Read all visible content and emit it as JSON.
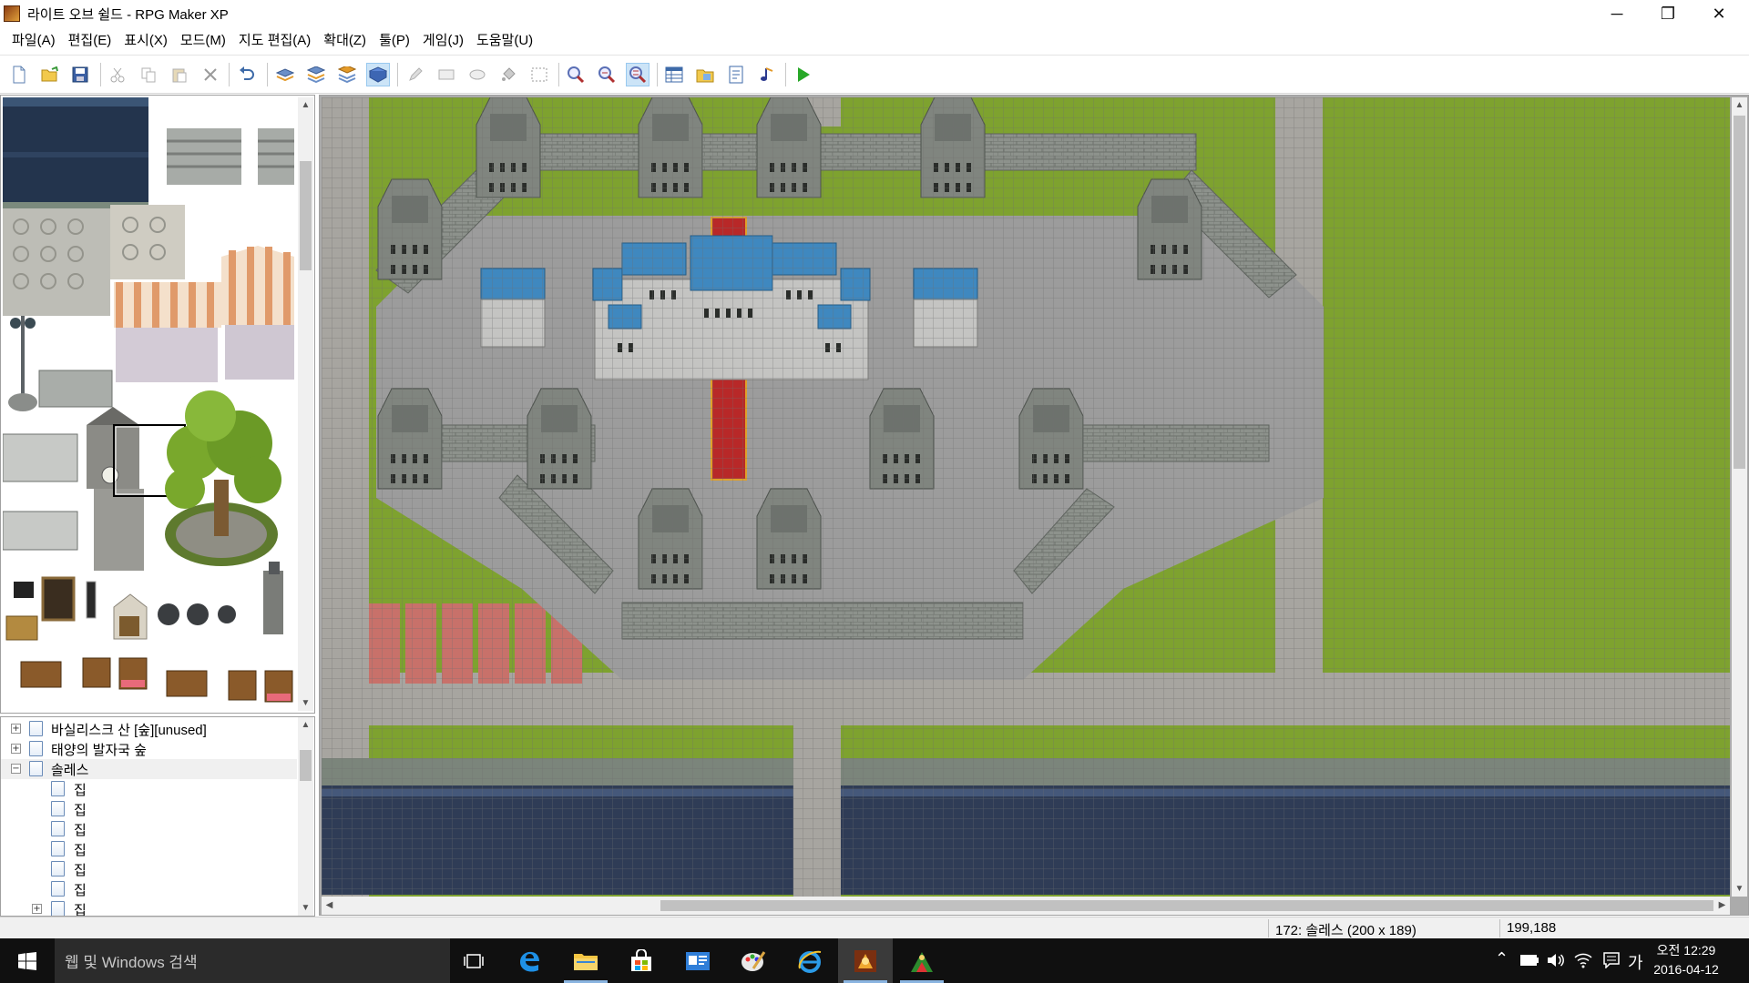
{
  "window": {
    "title": "라이트 오브 쉴드 - RPG Maker XP",
    "app_icon": "rpg-maker-xp-icon",
    "controls": {
      "minimize": "─",
      "restore": "❐",
      "close": "✕"
    }
  },
  "menu": {
    "items": [
      "파일(A)",
      "편집(E)",
      "표시(X)",
      "모드(M)",
      "지도 편집(A)",
      "확대(Z)",
      "툴(P)",
      "게임(J)",
      "도움말(U)"
    ]
  },
  "toolbar": {
    "buttons": [
      {
        "icon": "new-project-icon",
        "pressed": false
      },
      {
        "icon": "open-project-icon",
        "pressed": false
      },
      {
        "icon": "save-icon",
        "pressed": false
      },
      {
        "icon": "cut-icon",
        "pressed": false
      },
      {
        "icon": "copy-icon",
        "pressed": false
      },
      {
        "icon": "paste-icon",
        "pressed": false
      },
      {
        "icon": "delete-icon",
        "pressed": false
      },
      {
        "icon": "undo-icon",
        "pressed": false
      },
      {
        "icon": "layer-1-icon",
        "pressed": false
      },
      {
        "icon": "layer-2-icon",
        "pressed": false
      },
      {
        "icon": "layer-3-icon",
        "pressed": false
      },
      {
        "icon": "event-layer-icon",
        "pressed": true
      },
      {
        "icon": "pencil-icon",
        "pressed": false
      },
      {
        "icon": "rectangle-icon",
        "pressed": false
      },
      {
        "icon": "ellipse-icon",
        "pressed": false
      },
      {
        "icon": "fill-icon",
        "pressed": false
      },
      {
        "icon": "select-icon",
        "pressed": false
      },
      {
        "icon": "zoom-1-1-icon",
        "pressed": false
      },
      {
        "icon": "zoom-1-2-icon",
        "pressed": false
      },
      {
        "icon": "zoom-1-4-icon",
        "pressed": true
      },
      {
        "icon": "database-icon",
        "pressed": false
      },
      {
        "icon": "materials-icon",
        "pressed": false
      },
      {
        "icon": "script-editor-icon",
        "pressed": false
      },
      {
        "icon": "sound-test-icon",
        "pressed": false
      },
      {
        "icon": "playtest-icon",
        "pressed": false
      }
    ]
  },
  "map_tree": {
    "items": [
      {
        "label": "바실리스크 산 [숲][unused]",
        "expander": "+"
      },
      {
        "label": "태양의 발자국 숲",
        "expander": "+"
      },
      {
        "label": "솔레스",
        "expander": "−",
        "selected": true
      },
      {
        "label": "집"
      },
      {
        "label": "집"
      },
      {
        "label": "집"
      },
      {
        "label": "집"
      },
      {
        "label": "집"
      },
      {
        "label": "집"
      },
      {
        "label": "집"
      }
    ]
  },
  "status": {
    "map_info": "172: 솔레스 (200 x 189)",
    "coords": "199,188"
  },
  "taskbar": {
    "search_placeholder": "웹 및 Windows 검색",
    "apps": [
      "task-view-icon",
      "edge-icon",
      "file-explorer-icon",
      "store-icon",
      "contacts-icon",
      "paint-icon",
      "internet-explorer-icon",
      "rpg-maker-xp-icon",
      "rpg-game-icon"
    ],
    "tray": {
      "ime": "가"
    },
    "clock": {
      "time": "오전 12:29",
      "date": "2016-04-12"
    }
  },
  "colors": {
    "grass": "#7ea22f",
    "stone": "#9c9c9c",
    "wall": "#868b86",
    "roof": "#3f88bf",
    "carpet": "#b82828",
    "water": "#34405a",
    "grid": "#6f6f6f"
  }
}
